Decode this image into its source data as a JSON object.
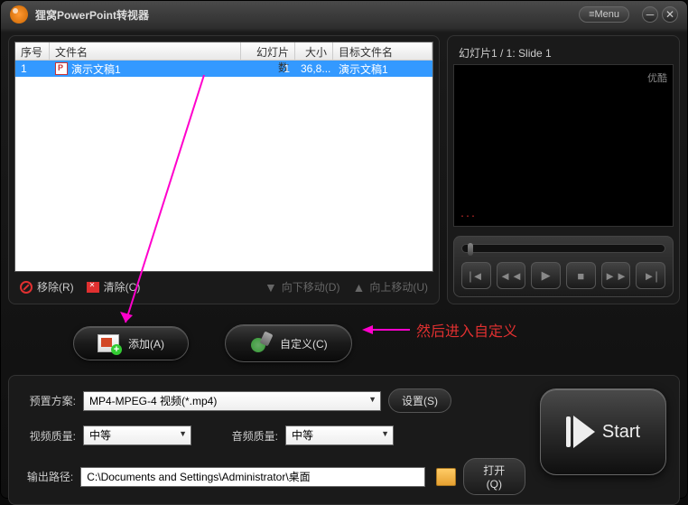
{
  "title": "狸窝PowerPoint转视器",
  "menu_label": "≡Menu",
  "table": {
    "headers": {
      "idx": "序号",
      "file": "文件名",
      "slides": "幻灯片数",
      "size": "大小",
      "target": "目标文件名"
    },
    "rows": [
      {
        "idx": "1",
        "file": "演示文稿1",
        "slides": "1",
        "size": "36,8...",
        "target": "演示文稿1"
      }
    ]
  },
  "toolbar": {
    "remove": "移除(R)",
    "clear": "清除(C)",
    "movedown": "向下移动(D)",
    "moveup": "向上移动(U)"
  },
  "preview": {
    "label": "幻灯片1 / 1: Slide 1",
    "watermark": "优酷",
    "text": "..."
  },
  "middle": {
    "add": "添加(A)",
    "customize": "自定义(C)",
    "annotation": "然后进入自定义"
  },
  "settings": {
    "preset_label": "预置方案:",
    "preset_value": "MP4-MPEG-4 视频(*.mp4)",
    "settings_btn": "设置(S)",
    "vq_label": "视频质量:",
    "vq_value": "中等",
    "aq_label": "音频质量:",
    "aq_value": "中等",
    "out_label": "输出路径:",
    "out_value": "C:\\Documents and Settings\\Administrator\\桌面",
    "open_btn": "打开(Q)"
  },
  "start": "Start"
}
